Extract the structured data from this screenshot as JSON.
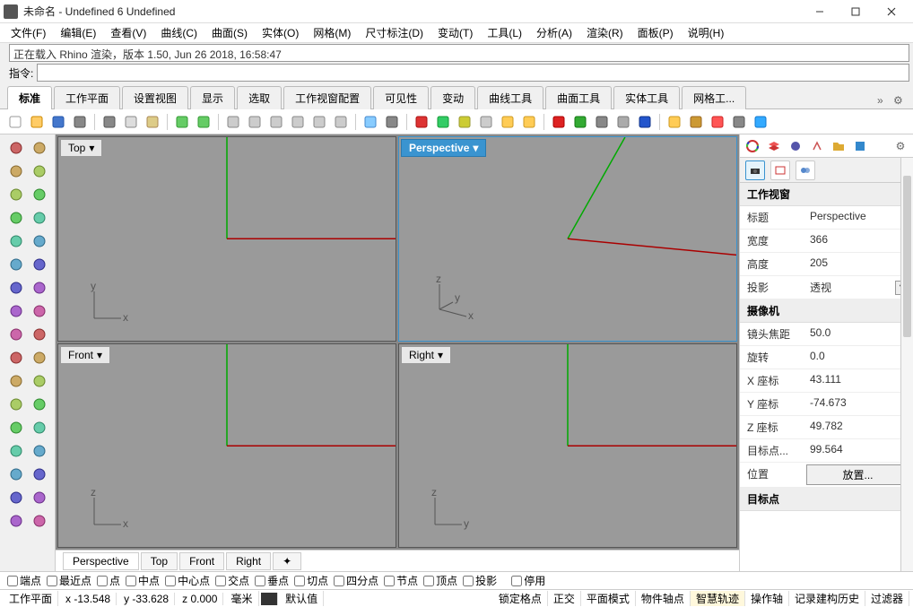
{
  "title": "未命名 - Undefined 6 Undefined",
  "menus": [
    "文件(F)",
    "编辑(E)",
    "查看(V)",
    "曲线(C)",
    "曲面(S)",
    "实体(O)",
    "网格(M)",
    "尺寸标注(D)",
    "变动(T)",
    "工具(L)",
    "分析(A)",
    "渲染(R)",
    "面板(P)",
    "说明(H)"
  ],
  "cmd_history": "正在载入 Rhino 渲染，版本 1.50, Jun 26 2018, 16:58:47",
  "cmd_label": "指令:",
  "ui_tabs": [
    "标准",
    "工作平面",
    "设置视图",
    "显示",
    "选取",
    "工作视窗配置",
    "可见性",
    "变动",
    "曲线工具",
    "曲面工具",
    "实体工具",
    "网格工..."
  ],
  "active_ui_tab": 0,
  "viewports": {
    "tl": {
      "label": "Top",
      "axes": [
        "x",
        "y"
      ]
    },
    "tr": {
      "label": "Perspective",
      "axes": [
        "x",
        "y",
        "z"
      ]
    },
    "bl": {
      "label": "Front",
      "axes": [
        "x",
        "z"
      ]
    },
    "br": {
      "label": "Right",
      "axes": [
        "y",
        "z"
      ]
    }
  },
  "active_viewport": "tr",
  "vp_tabs": [
    "Perspective",
    "Top",
    "Front",
    "Right"
  ],
  "active_vp_tab": 0,
  "right_panel": {
    "headers": {
      "viewport": "工作视窗",
      "camera": "摄像机",
      "target": "目标点"
    },
    "viewport": {
      "title_label": "标题",
      "title": "Perspective",
      "width_label": "宽度",
      "width": "366",
      "height_label": "高度",
      "height": "205",
      "proj_label": "投影",
      "proj": "透视"
    },
    "camera": {
      "focal_label": "镜头焦距",
      "focal": "50.0",
      "rot_label": "旋转",
      "rot": "0.0",
      "x_label": "X 座标",
      "x": "43.111",
      "y_label": "Y 座标",
      "y": "-74.673",
      "z_label": "Z 座标",
      "z": "49.782",
      "target_label": "目标点...",
      "target": "99.564",
      "pos_label": "位置",
      "pos_btn": "放置..."
    }
  },
  "osnap": [
    "端点",
    "最近点",
    "点",
    "中点",
    "中心点",
    "交点",
    "垂点",
    "切点",
    "四分点",
    "节点",
    "顶点",
    "投影"
  ],
  "osnap_disable": "停用",
  "status": {
    "cplane": "工作平面",
    "x": "x -13.548",
    "y": "y -33.628",
    "z": "z 0.000",
    "unit": "毫米",
    "layer": "默认值",
    "segments": [
      "锁定格点",
      "正交",
      "平面模式",
      "物件轴点",
      "智慧轨迹",
      "操作轴",
      "记录建构历史",
      "过滤器"
    ],
    "highlight_idx": 4
  }
}
